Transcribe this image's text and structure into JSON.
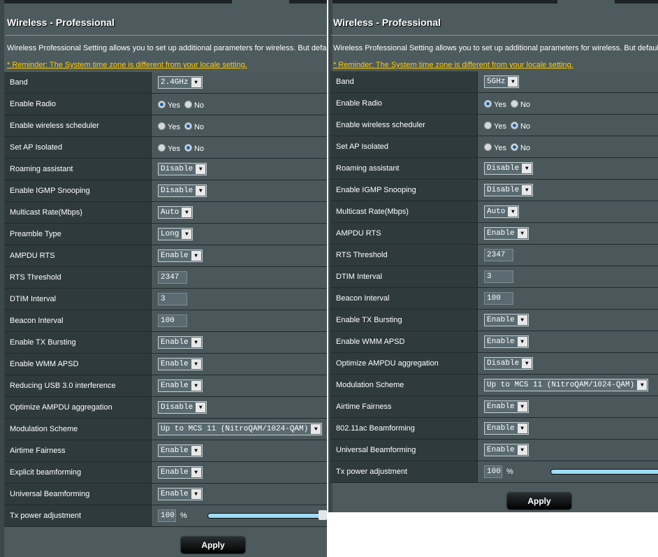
{
  "panels": [
    {
      "title": "Wireless - Professional",
      "description": "Wireless Professional Setting allows you to set up additional parameters for wireless. But default v",
      "reminder": "* Reminder: The System time zone is different from your locale setting.",
      "rows": [
        {
          "label": "Band",
          "type": "select",
          "value": "2.4GHz"
        },
        {
          "label": "Enable Radio",
          "type": "radio",
          "value": "Yes"
        },
        {
          "label": "Enable wireless scheduler",
          "type": "radio",
          "value": "No"
        },
        {
          "label": "Set AP Isolated",
          "type": "radio",
          "value": "No"
        },
        {
          "label": "Roaming assistant",
          "type": "select",
          "value": "Disable"
        },
        {
          "label": "Enable IGMP Snooping",
          "type": "select",
          "value": "Disable"
        },
        {
          "label": "Multicast Rate(Mbps)",
          "type": "select",
          "value": "Auto"
        },
        {
          "label": "Preamble Type",
          "type": "select",
          "value": "Long"
        },
        {
          "label": "AMPDU RTS",
          "type": "select",
          "value": "Enable"
        },
        {
          "label": "RTS Threshold",
          "type": "text",
          "value": "2347"
        },
        {
          "label": "DTIM Interval",
          "type": "text",
          "value": "3"
        },
        {
          "label": "Beacon Interval",
          "type": "text",
          "value": "100"
        },
        {
          "label": "Enable TX Bursting",
          "type": "select",
          "value": "Enable"
        },
        {
          "label": "Enable WMM APSD",
          "type": "select",
          "value": "Enable"
        },
        {
          "label": "Reducing USB 3.0 interference",
          "type": "select",
          "value": "Enable"
        },
        {
          "label": "Optimize AMPDU aggregation",
          "type": "select",
          "value": "Disable"
        },
        {
          "label": "Modulation Scheme",
          "type": "select",
          "value": "Up to MCS 11 (NitroQAM/1024-QAM)"
        },
        {
          "label": "Airtime Fairness",
          "type": "select",
          "value": "Enable"
        },
        {
          "label": "Explicit beamforming",
          "type": "select",
          "value": "Enable"
        },
        {
          "label": "Universal Beamforming",
          "type": "select",
          "value": "Enable"
        },
        {
          "label": "Tx power adjustment",
          "type": "power",
          "value": "100",
          "unit": "%",
          "level_percent": 100
        }
      ],
      "apply_label": "Apply"
    },
    {
      "title": "Wireless - Professional",
      "description": "Wireless Professional Setting allows you to set up additional parameters for wireless. But default val",
      "reminder": "* Reminder: The System time zone is different from your locale setting.",
      "rows": [
        {
          "label": "Band",
          "type": "select",
          "value": "5GHz"
        },
        {
          "label": "Enable Radio",
          "type": "radio",
          "value": "Yes"
        },
        {
          "label": "Enable wireless scheduler",
          "type": "radio",
          "value": "No"
        },
        {
          "label": "Set AP Isolated",
          "type": "radio",
          "value": "No"
        },
        {
          "label": "Roaming assistant",
          "type": "select",
          "value": "Disable"
        },
        {
          "label": "Enable IGMP Snooping",
          "type": "select",
          "value": "Disable"
        },
        {
          "label": "Multicast Rate(Mbps)",
          "type": "select",
          "value": "Auto"
        },
        {
          "label": "AMPDU RTS",
          "type": "select",
          "value": "Enable"
        },
        {
          "label": "RTS Threshold",
          "type": "text",
          "value": "2347"
        },
        {
          "label": "DTIM Interval",
          "type": "text",
          "value": "3"
        },
        {
          "label": "Beacon Interval",
          "type": "text",
          "value": "100"
        },
        {
          "label": "Enable TX Bursting",
          "type": "select",
          "value": "Enable"
        },
        {
          "label": "Enable WMM APSD",
          "type": "select",
          "value": "Enable"
        },
        {
          "label": "Optimize AMPDU aggregation",
          "type": "select",
          "value": "Disable"
        },
        {
          "label": "Modulation Scheme",
          "type": "select",
          "value": "Up to MCS 11 (NitroQAM/1024-QAM)"
        },
        {
          "label": "Airtime Fairness",
          "type": "select",
          "value": "Enable"
        },
        {
          "label": "802.11ac Beamforming",
          "type": "select",
          "value": "Enable"
        },
        {
          "label": "Universal Beamforming",
          "type": "select",
          "value": "Enable"
        },
        {
          "label": "Tx power adjustment",
          "type": "power",
          "value": "100",
          "unit": "%",
          "level_percent": 100
        }
      ],
      "apply_label": "Apply"
    }
  ],
  "radio_options": [
    "Yes",
    "No"
  ],
  "colors": {
    "reminder": "#ffcc00",
    "slider_fill": "#9fdcf5",
    "radio_checked": "#1a5fb4"
  }
}
